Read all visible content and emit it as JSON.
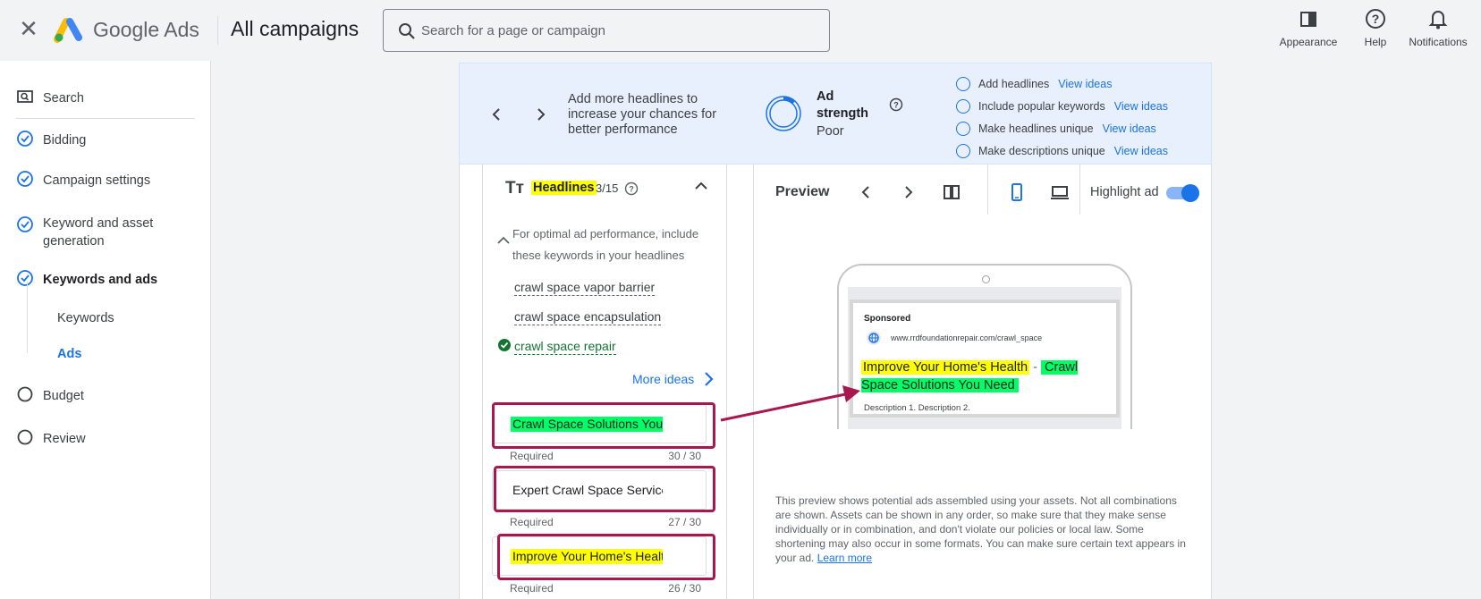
{
  "header": {
    "brand": "Google Ads",
    "page_title": "All campaigns",
    "search_placeholder": "Search for a page or campaign",
    "tools": [
      {
        "label": "Appearance",
        "icon": "appearance-icon"
      },
      {
        "label": "Help",
        "icon": "help-icon"
      },
      {
        "label": "Notifications",
        "icon": "bell-icon"
      }
    ]
  },
  "sidebar": {
    "items": [
      {
        "label": "Search",
        "icon": "search-campaign-icon",
        "state": "type"
      },
      {
        "label": "Bidding",
        "icon": "check-circle-icon",
        "state": "done"
      },
      {
        "label": "Campaign settings",
        "icon": "check-circle-icon",
        "state": "done"
      },
      {
        "label": "Keyword and asset generation",
        "icon": "check-circle-icon",
        "state": "done"
      },
      {
        "label": "Keywords and ads",
        "icon": "check-circle-icon",
        "state": "current"
      },
      {
        "label": "Budget",
        "icon": "empty-circle-icon",
        "state": "todo"
      },
      {
        "label": "Review",
        "icon": "empty-circle-icon",
        "state": "todo"
      }
    ],
    "subitems": [
      {
        "label": "Keywords",
        "active": false
      },
      {
        "label": "Ads",
        "active": true
      }
    ]
  },
  "banner": {
    "message": "Add more headlines to increase your chances for better performance",
    "ad_strength_label": "Ad strength",
    "ad_strength_value": "Poor",
    "ad_strength_fraction": 0.12,
    "tips": [
      {
        "label": "Add headlines",
        "link": "View ideas"
      },
      {
        "label": "Include popular keywords",
        "link": "View ideas"
      },
      {
        "label": "Make headlines unique",
        "link": "View ideas"
      },
      {
        "label": "Make descriptions unique",
        "link": "View ideas"
      }
    ]
  },
  "headlines": {
    "title": "Headlines",
    "count": "3/15",
    "keyword_note": "For optimal ad performance, include these keywords in your headlines",
    "keywords": [
      {
        "text": "crawl space vapor barrier",
        "included": false
      },
      {
        "text": "crawl space encapsulation",
        "included": false
      },
      {
        "text": "crawl space repair",
        "included": true
      }
    ],
    "more_ideas": "More ideas",
    "fields": [
      {
        "value": "Crawl Space Solutions You Need",
        "meta": "Required",
        "count": "30 / 30",
        "highlight": "green"
      },
      {
        "value": "Expert Crawl Space Services",
        "meta": "Required",
        "count": "27 / 30",
        "highlight": "none"
      },
      {
        "value": "Improve Your Home's Health",
        "meta": "Required",
        "count": "26 / 30",
        "highlight": "yellow"
      }
    ]
  },
  "preview": {
    "title": "Preview",
    "highlight_label": "Highlight ad",
    "highlight_on": true,
    "ad": {
      "sponsored": "Sponsored",
      "url": "www.rrdfoundationrepair.com/crawl_space",
      "headline_1": "Improve Your Home's Health",
      "separator": "-",
      "headline_2": "Crawl Space Solutions You Need",
      "description": "Description 1. Description 2."
    },
    "disclaimer": "This preview shows potential ads assembled using your assets. Not all combinations are shown. Assets can be shown in any order, so make sure that they make sense individually or in combination, and don't violate our policies or local law. Some shortening may also occur in some formats. You can make sure certain text appears in your ad.",
    "learn_more": "Learn more"
  },
  "colors": {
    "accent": "#1a73e8",
    "annotation": "#a8174e",
    "highlight_green": "#00ff66",
    "highlight_yellow": "#ffff00"
  }
}
